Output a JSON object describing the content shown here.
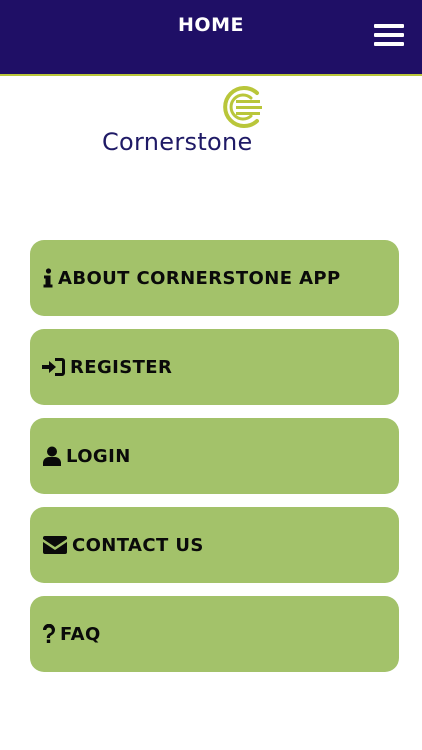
{
  "header": {
    "title": "HOME",
    "menu_icon": "hamburger-menu-icon",
    "background": "#1f0f66",
    "accent": "#b9c63a"
  },
  "logo": {
    "text": "Cornerstone",
    "text_color": "#1f1a66",
    "mark_color": "#b9c63a"
  },
  "menu": {
    "button_color": "#a3c26a",
    "items": [
      {
        "label": "ABOUT CORNERSTONE APP",
        "icon": "info-icon"
      },
      {
        "label": "REGISTER",
        "icon": "sign-in-icon"
      },
      {
        "label": "LOGIN",
        "icon": "user-icon"
      },
      {
        "label": "CONTACT US",
        "icon": "envelope-icon"
      },
      {
        "label": "FAQ",
        "icon": "question-icon"
      }
    ]
  }
}
